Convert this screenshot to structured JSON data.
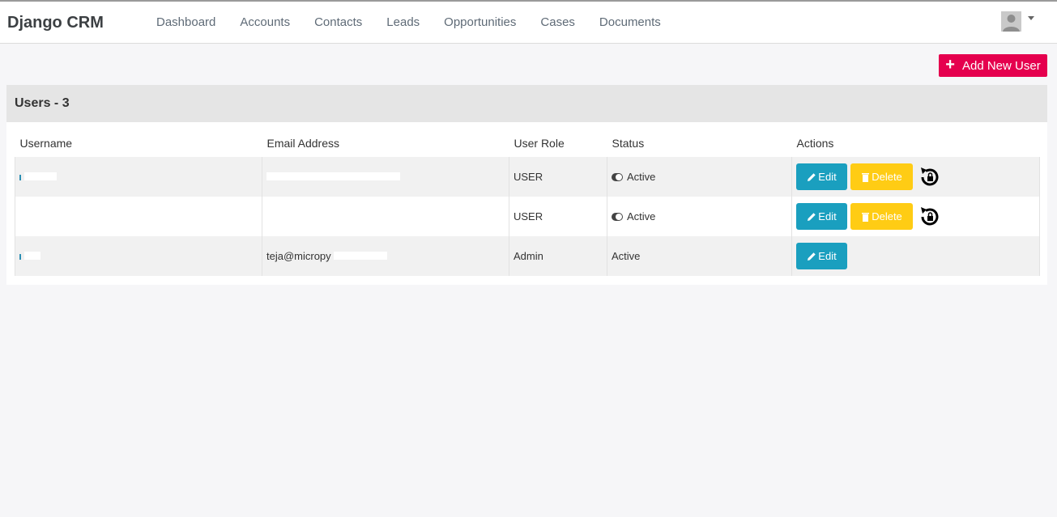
{
  "app": {
    "brand": "Django CRM"
  },
  "nav": {
    "items": [
      "Dashboard",
      "Accounts",
      "Contacts",
      "Leads",
      "Opportunities",
      "Cases",
      "Documents"
    ]
  },
  "header_user": {
    "avatar_icon": "user-avatar-icon",
    "caret_icon": "caret-down-icon"
  },
  "add_button": {
    "label": "Add New User",
    "icon": "plus-icon",
    "color": "#e5004e"
  },
  "panel": {
    "title": "Users - 3"
  },
  "table": {
    "columns": [
      "Username",
      "Email Address",
      "User Role",
      "Status",
      "Actions"
    ],
    "rows": [
      {
        "username": "",
        "email": "",
        "role": "USER",
        "status": "Active",
        "edit": "Edit",
        "delete": "Delete"
      },
      {
        "username": "",
        "email": "",
        "role": "USER",
        "status": "Active",
        "edit": "Edit",
        "delete": "Delete"
      },
      {
        "username": "",
        "email": "teja@micropy",
        "role": "Admin",
        "status": "Active",
        "edit": "Edit"
      }
    ]
  },
  "colors": {
    "edit": "#1a9fbf",
    "delete": "#ffcc14",
    "header_bg": "#e5e5e5"
  }
}
